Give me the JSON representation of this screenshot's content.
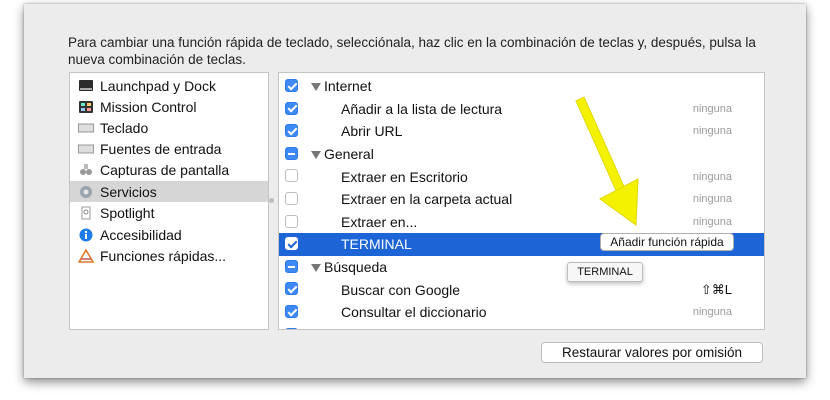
{
  "instructions": "Para cambiar una función rápida de teclado, selecciónala, haz clic en la combinación de teclas y, después, pulsa la nueva combinación de teclas.",
  "categories": [
    {
      "label": "Launchpad y Dock",
      "icon": "launchpad-dock-icon"
    },
    {
      "label": "Mission Control",
      "icon": "mission-control-icon"
    },
    {
      "label": "Teclado",
      "icon": "keyboard-icon"
    },
    {
      "label": "Fuentes de entrada",
      "icon": "input-sources-icon"
    },
    {
      "label": "Capturas de pantalla",
      "icon": "screenshot-icon"
    },
    {
      "label": "Servicios",
      "icon": "gear-icon",
      "selected": true
    },
    {
      "label": "Spotlight",
      "icon": "spotlight-icon"
    },
    {
      "label": "Accesibilidad",
      "icon": "accessibility-icon"
    },
    {
      "label": "Funciones rápidas...",
      "icon": "app-shortcuts-icon"
    }
  ],
  "shortcuts": [
    {
      "type": "group",
      "label": "Internet",
      "state": "on"
    },
    {
      "type": "item",
      "label": "Añadir a la lista de lectura",
      "state": "on",
      "shortcut": "ninguna"
    },
    {
      "type": "item",
      "label": "Abrir URL",
      "state": "on",
      "shortcut": "ninguna"
    },
    {
      "type": "group",
      "label": "General",
      "state": "mixed"
    },
    {
      "type": "item",
      "label": "Extraer en Escritorio",
      "state": "off",
      "shortcut": "ninguna"
    },
    {
      "type": "item",
      "label": "Extraer en la carpeta actual",
      "state": "off",
      "shortcut": "ninguna"
    },
    {
      "type": "item",
      "label": "Extraer en...",
      "state": "off",
      "shortcut": "ninguna"
    },
    {
      "type": "item",
      "label": "TERMINAL",
      "state": "on",
      "shortcut": "",
      "selected": true
    },
    {
      "type": "group",
      "label": "Búsqueda",
      "state": "mixed"
    },
    {
      "type": "item",
      "label": "Buscar con Google",
      "state": "on",
      "shortcut": "⇧⌘L"
    },
    {
      "type": "item",
      "label": "Consultar el diccionario",
      "state": "on",
      "shortcut": "ninguna"
    },
    {
      "type": "item",
      "label": "",
      "state": "on",
      "shortcut": ""
    }
  ],
  "add_shortcut_button": "Añadir función rápida",
  "tooltip": "TERMINAL",
  "restore_button": "Restaurar valores por omisión",
  "colors": {
    "selection": "#1d64d6",
    "checkbox": "#3d8af7",
    "arrow": "#f5f200"
  }
}
